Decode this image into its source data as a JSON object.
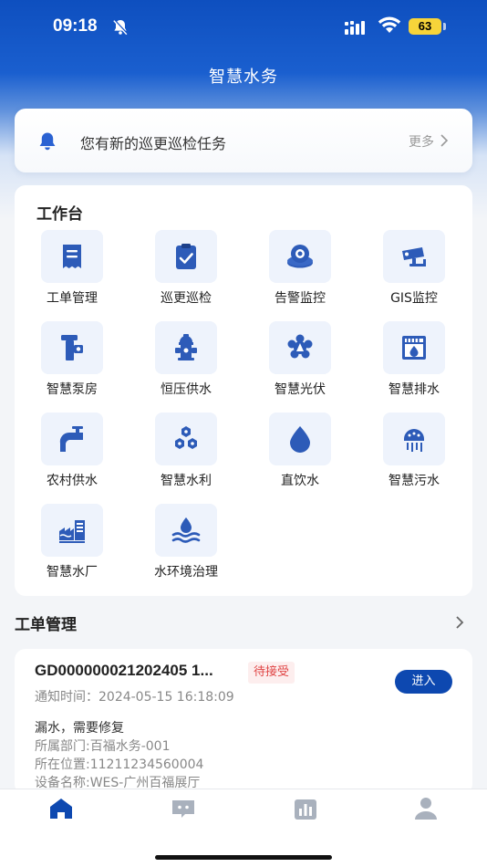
{
  "status_bar": {
    "time": "09:18",
    "battery": "63"
  },
  "app": {
    "title": "智慧水务"
  },
  "notice": {
    "text": "您有新的巡更巡检任务",
    "more_label": "更多"
  },
  "workbench": {
    "title": "工作台",
    "items": [
      {
        "label": "工单管理",
        "icon": "work-order-icon"
      },
      {
        "label": "巡更巡检",
        "icon": "patrol-check-icon"
      },
      {
        "label": "告警监控",
        "icon": "alarm-monitor-icon"
      },
      {
        "label": "GIS监控",
        "icon": "cctv-camera-icon"
      },
      {
        "label": "智慧泵房",
        "icon": "pump-room-icon"
      },
      {
        "label": "恒压供水",
        "icon": "fire-hydrant-icon"
      },
      {
        "label": "智慧光伏",
        "icon": "photovoltaic-icon"
      },
      {
        "label": "智慧排水",
        "icon": "drainage-icon"
      },
      {
        "label": "农村供水",
        "icon": "faucet-icon"
      },
      {
        "label": "智慧水利",
        "icon": "hexagon-cluster-icon"
      },
      {
        "label": "直饮水",
        "icon": "water-drop-icon"
      },
      {
        "label": "智慧污水",
        "icon": "sewage-icon"
      },
      {
        "label": "智慧水厂",
        "icon": "water-plant-icon"
      },
      {
        "label": "水环境治理",
        "icon": "water-environment-icon"
      }
    ]
  },
  "work_orders": {
    "section_title": "工单管理",
    "items": [
      {
        "order_no": "GD000000021202405 1...",
        "status": "待接受",
        "enter_label": "进入",
        "notify_time": "通知时间：2024-05-15 16:18:09",
        "description": "漏水，需要修复",
        "department": "所属部门:百福水务-001",
        "location": "所在位置:11211234560004",
        "device": "设备名称:WES-广州百福展厅"
      }
    ]
  },
  "tabbar": {
    "tabs": [
      {
        "icon": "home-icon",
        "active": true
      },
      {
        "icon": "message-icon",
        "active": false
      },
      {
        "icon": "statistics-icon",
        "active": false
      },
      {
        "icon": "profile-icon",
        "active": false
      }
    ]
  },
  "colors": {
    "primary": "#0d48b0",
    "icon_blue": "#2d5bb8",
    "tile_bg": "#eef3fc",
    "status_red": "#e04545"
  }
}
